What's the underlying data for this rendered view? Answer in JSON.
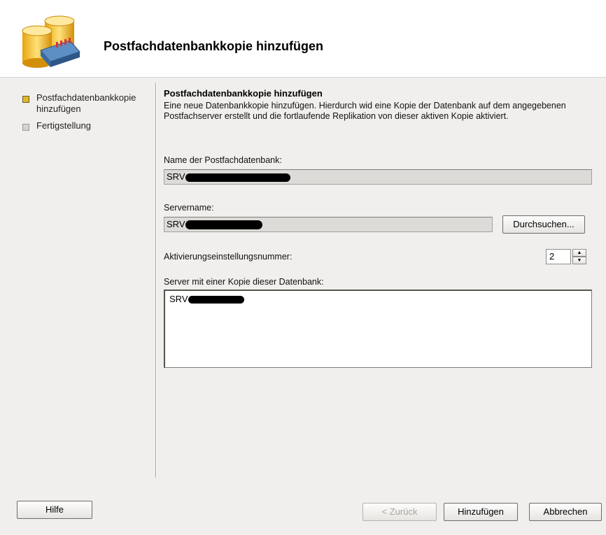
{
  "header": {
    "title": "Postfachdatenbankkopie hinzufügen",
    "icon": "database-icon"
  },
  "nav": {
    "items": [
      {
        "label": "Postfachdatenbankkopie hinzufügen",
        "state": "active"
      },
      {
        "label": "Fertigstellung",
        "state": "inactive"
      }
    ]
  },
  "content": {
    "section_title": "Postfachdatenbankkopie hinzufügen",
    "description": "Eine neue Datenbankkopie hinzufügen. Hierdurch wid eine Kopie der Datenbank auf dem angegebenen Postfachserver erstellt und die fortlaufende Replikation von dieser aktiven Kopie aktiviert.",
    "db_name_label": "Name der Postfachdatenbank:",
    "db_name_value": "SRV",
    "server_label": "Servername:",
    "server_value": "SRV",
    "browse_label": "Durchsuchen...",
    "activation_label": "Aktivierungseinstellungsnummer:",
    "activation_value": "2",
    "copies_label": "Server mit einer Kopie dieser Datenbank:",
    "copies_items": [
      "SRV"
    ]
  },
  "footer": {
    "help_label": "Hilfe",
    "back_label": "< Zurück",
    "add_label": "Hinzufügen",
    "cancel_label": "Abbrechen"
  },
  "colors": {
    "active_bullet": "#e0b82c",
    "inactive_bullet": "#d4d3d1",
    "window_bg": "#f0efed"
  }
}
